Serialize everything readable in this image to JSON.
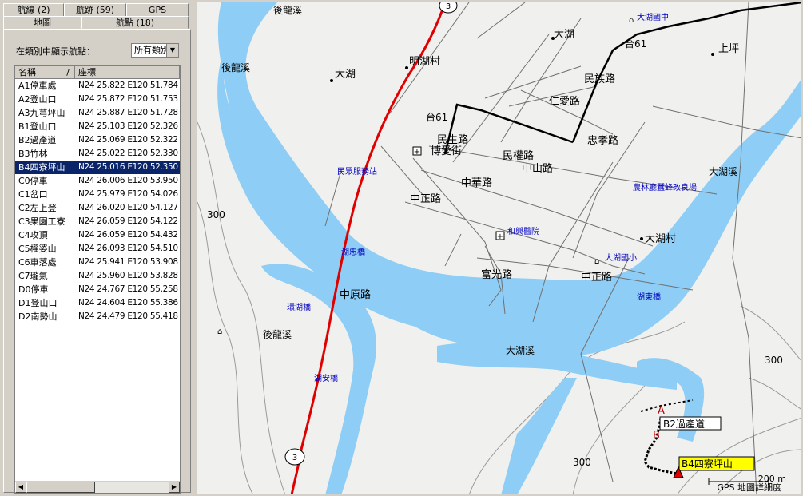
{
  "tabs_row1": [
    "航線 (2)",
    "航跡 (59)",
    "GPS"
  ],
  "tabs_row2": [
    "地圖",
    "航點 (18)"
  ],
  "filter": {
    "label": "在類別中顯示航點：",
    "value": "所有類別"
  },
  "columns": {
    "name": "名稱",
    "sort": "/",
    "coord": "座標"
  },
  "waypoints": [
    {
      "name": "A1停車處",
      "coord": "N24 25.822 E120 51.784"
    },
    {
      "name": "A2登山口",
      "coord": "N24 25.872 E120 51.753"
    },
    {
      "name": "A3九芎坪山",
      "coord": "N24 25.887 E120 51.728"
    },
    {
      "name": "B1登山口",
      "coord": "N24 25.103 E120 52.326"
    },
    {
      "name": "B2過產道",
      "coord": "N24 25.069 E120 52.322"
    },
    {
      "name": "B3竹林",
      "coord": "N24 25.022 E120 52.330"
    },
    {
      "name": "B4四寮坪山",
      "coord": "N24 25.016 E120 52.350"
    },
    {
      "name": "C0停車",
      "coord": "N24 26.006 E120 53.950"
    },
    {
      "name": "C1岔口",
      "coord": "N24 25.979 E120 54.026"
    },
    {
      "name": "C2左上登",
      "coord": "N24 26.020 E120 54.127"
    },
    {
      "name": "C3果園工寮",
      "coord": "N24 26.059 E120 54.122"
    },
    {
      "name": "C4攻頂",
      "coord": "N24 26.059 E120 54.432"
    },
    {
      "name": "C5櫂婆山",
      "coord": "N24 26.093 E120 54.510"
    },
    {
      "name": "C6車落處",
      "coord": "N24 25.941 E120 53.908"
    },
    {
      "name": "C7瓏氣",
      "coord": "N24 25.960 E120 53.828"
    },
    {
      "name": "D0停車",
      "coord": "N24 24.767 E120 55.258"
    },
    {
      "name": "D1登山口",
      "coord": "N24 24.604 E120 55.386"
    },
    {
      "name": "D2南勢山",
      "coord": "N24 24.479 E120 55.418"
    }
  ],
  "selected_index": 6,
  "map": {
    "labels": {
      "houlongxi1": "後龍溪",
      "houlongxi2": "後龍溪",
      "houlongxi3": "後龍溪",
      "dahu1": "大湖",
      "dahu2": "大湖",
      "minghucun": "明湖村",
      "dahu_school1": "大湖國中",
      "shangping": "上坪",
      "tai61a": "台61",
      "tai61b": "台61",
      "minzu": "民族路",
      "renai": "仁愛路",
      "minsheng": "民生路",
      "zhongxiao": "忠孝路",
      "boai": "博愛街",
      "minquan": "民權路",
      "zhongshan": "中山路",
      "zhonghua": "中華路",
      "zhongzheng1": "中正路",
      "zhongzheng2": "中正路",
      "fuguang": "富光路",
      "zhongyuan": "中原路",
      "dahuxi1": "大湖溪",
      "dahuxi2": "大湖溪",
      "dahucun": "大湖村",
      "dahu_school2": "大湖國小",
      "service": "民眾服務站",
      "farm": "農林廳蠶蜂改良場",
      "hospital": "和興醫院",
      "huzhong": "湖忠橋",
      "huandong": "環湖橋",
      "hudong": "湖東橋",
      "huan": "湖安橋",
      "c300a": "300",
      "c300b": "300",
      "c300c": "300",
      "route3": "3"
    },
    "wp_a": "A",
    "wp_b": "B",
    "callout_b2": "B2過產道",
    "callout_b4": "B4四寮坪山",
    "scale": "200 m",
    "detail": "GPS 地圖詳細度"
  },
  "colors": {
    "river": "#8ecdf5",
    "road": "#000000",
    "highway": "#e00000",
    "label_blue": "#0000c0",
    "callout_bg": "#ffff00"
  }
}
